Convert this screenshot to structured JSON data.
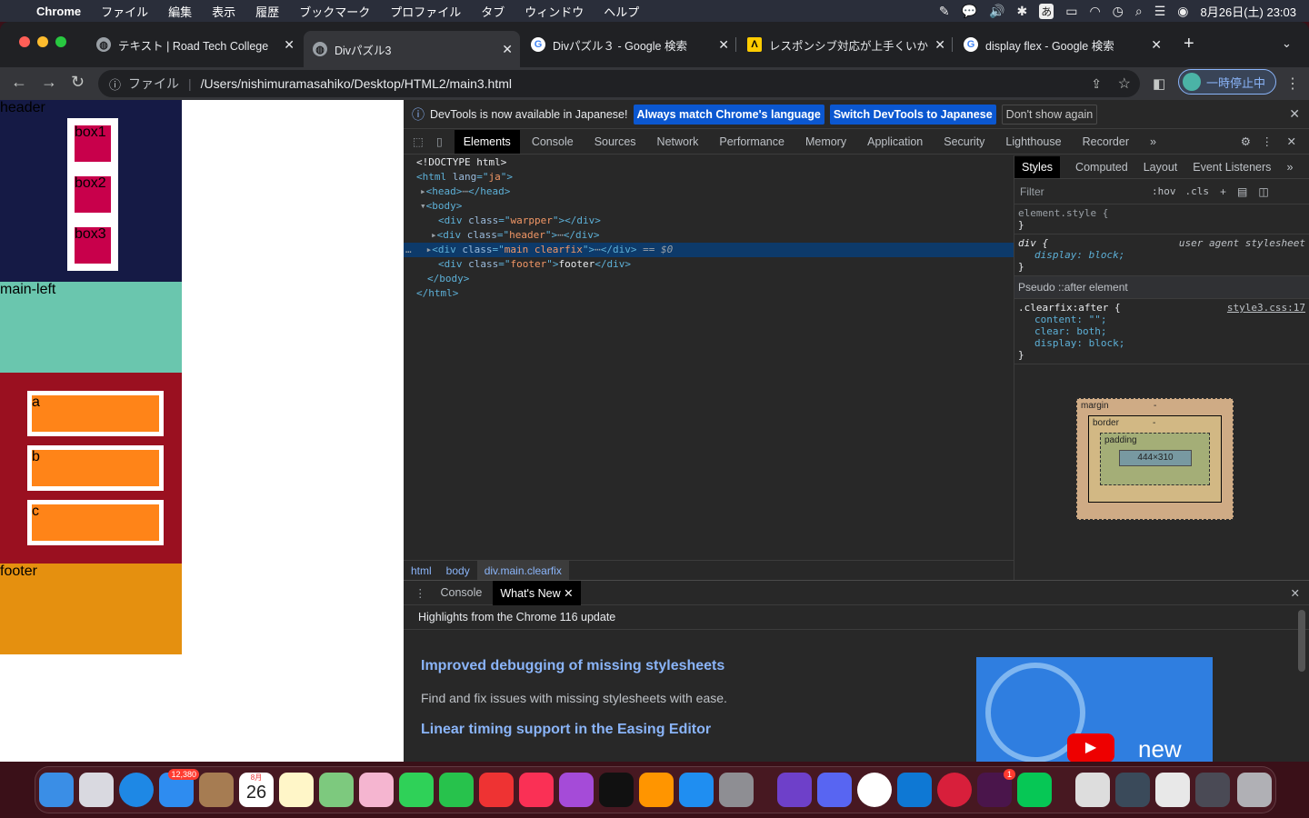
{
  "menubar": {
    "app": "Chrome",
    "items": [
      "ファイル",
      "編集",
      "表示",
      "履歴",
      "ブックマーク",
      "プロファイル",
      "タブ",
      "ウィンドウ",
      "ヘルプ"
    ],
    "ime": "あ",
    "clock": "8月26日(土)  23:03"
  },
  "tabs": [
    {
      "title": "テキスト | Road Tech College"
    },
    {
      "title": "Divパズル3"
    },
    {
      "title": "Divパズル３ - Google 検索"
    },
    {
      "title": "レスポンシブ対応が上手くいかない"
    },
    {
      "title": "display flex - Google 検索"
    }
  ],
  "toolbar": {
    "scheme": "ファイル",
    "url": "/Users/nishimuramasahiko/Desktop/HTML2/main3.html",
    "profile": "一時停止中"
  },
  "page": {
    "header": "header",
    "boxes": [
      "box1",
      "box2",
      "box3"
    ],
    "main_left": "main-left",
    "items": [
      "a",
      "b",
      "c"
    ],
    "footer": "footer"
  },
  "devtools": {
    "info": "DevTools is now available in Japanese!",
    "btn_match": "Always match Chrome's language",
    "btn_switch": "Switch DevTools to Japanese",
    "btn_dont": "Don't show again",
    "tabs": [
      "Elements",
      "Console",
      "Sources",
      "Network",
      "Performance",
      "Memory",
      "Application",
      "Security",
      "Lighthouse",
      "Recorder"
    ],
    "dom": {
      "l1": "<!DOCTYPE html>",
      "l2a": "<html ",
      "l2b": "lang",
      "l2c": "=\"",
      "l2d": "ja",
      "l2e": "\">",
      "l3": "<head>",
      "l3b": "</head>",
      "l4": "<body>",
      "wr_cls": "warpper",
      "hd_cls": "header",
      "mn_cls": "main clearfix",
      "ft_cls": "footer",
      "ft_txt": "footer",
      "sel_mark": "== $0",
      "l9": "</body>",
      "l10": "</html>"
    },
    "crumbs": [
      "html",
      "body",
      "div.main.clearfix"
    ],
    "styles_tabs": [
      "Styles",
      "Computed",
      "Layout",
      "Event Listeners"
    ],
    "filter": "Filter",
    "hov": ":hov",
    "cls": ".cls",
    "element_style": "element.style {",
    "div_rule": "div {",
    "ua": "user agent stylesheet",
    "display_block": "display: block;",
    "pseudo": "Pseudo ::after element",
    "clearfix": ".clearfix:after {",
    "src": "style3.css:17",
    "content_decl": "content: \"\";",
    "clear_decl": "clear: both;",
    "display_decl": "display: block;",
    "close_brace": "}",
    "bm": {
      "margin": "margin",
      "border": "border",
      "padding": "padding",
      "size": "444×310",
      "dash": "-"
    },
    "drawer": {
      "tabs": [
        "Console",
        "What's New"
      ],
      "highlight": "Highlights from the Chrome 116 update",
      "h1": "Improved debugging of missing stylesheets",
      "p1": "Find and fix issues with missing stylesheets with ease.",
      "h2": "Linear timing support in the Easing Editor",
      "video_text": "new"
    }
  },
  "dock": {
    "mail_badge": "12,380",
    "cal_month": "8月",
    "cal_day": "26",
    "slack_badge": "1"
  }
}
